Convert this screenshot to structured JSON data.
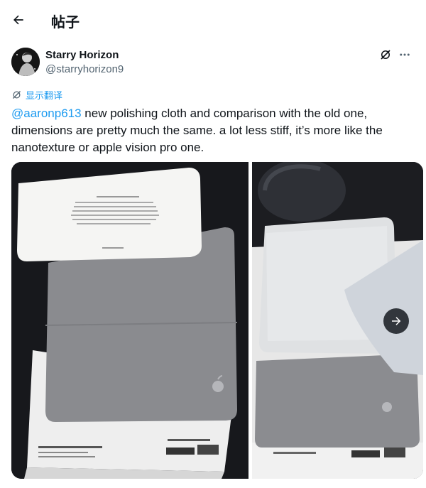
{
  "header": {
    "title": "帖子",
    "back_icon": "arrow-left-icon"
  },
  "author": {
    "name": "Starry Horizon",
    "handle": "@starryhorizon9"
  },
  "translate": {
    "label": "显示翻译"
  },
  "tweet": {
    "mention": "@aaronp613",
    "text": " new polishing cloth and comparison with the old one, dimensions are pretty much the same. a lot less stiff, it’s more like the nanotexture or apple vision pro one."
  },
  "media": {
    "photo_count": 2,
    "next_icon": "arrow-right-icon"
  },
  "colors": {
    "accent": "#1d9bf0",
    "secondary_text": "#536471",
    "text": "#0f1419"
  }
}
